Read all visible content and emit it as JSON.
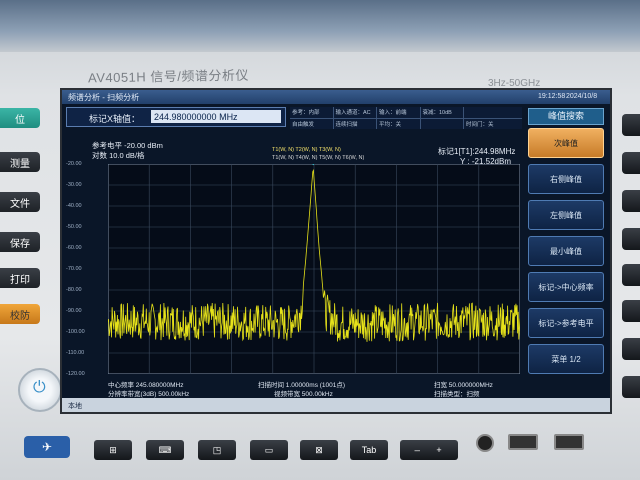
{
  "device": {
    "model": "AV4051H 信号/频谱分析仪",
    "range": "3Hz-50GHz",
    "left_keys": [
      "位",
      "测量",
      "文件",
      "保存",
      "打印",
      "校防"
    ],
    "bottom_keys": [
      "",
      "",
      "",
      "",
      "",
      "Tab",
      "—",
      "+"
    ]
  },
  "screen": {
    "title": "频谱分析 - 扫频分析",
    "time": "19:12:58",
    "date": "2024/10/8",
    "marker_label": "标记X轴值：",
    "marker_value": "244.980000000 MHz",
    "params": [
      "参考：内部",
      "输入通道：AC",
      "输入：前端",
      "衰减：10dB",
      "",
      "自由触发",
      "连续扫描",
      "平均：关",
      "",
      "时间门：关"
    ],
    "ref_level": "参考电平 -20.00 dBm",
    "scale_div": "对数 10.0 dB/格",
    "trace_line1": "T1(W, N)  T2(W, N)  T3(W, N)",
    "trace_line2": "T1(W, N)  T4(W, N)  T5(W, N)  T6(W, N)",
    "marker_readout_1": "标记1[T1]:244.98MHz",
    "marker_readout_2": "Y : -21.52dBm",
    "y_ticks": [
      "-20.00",
      "-30.00",
      "-40.00",
      "-50.00",
      "-60.00",
      "-70.00",
      "-80.00",
      "-90.00",
      "-100.00",
      "-110.00",
      "-120.00"
    ],
    "footer": {
      "center_freq": "中心频率 245.080000MHz",
      "res_bw": "分辨率带宽(3dB) 500.00kHz",
      "sweep_time": "扫描时间 1.00000ms (1001点)",
      "video_bw": "视频带宽 500.00kHz",
      "span": "扫宽 50.000000MHz",
      "sweep_type": "扫描类型：扫频"
    },
    "status": "本地",
    "softkey_title": "峰值搜索",
    "softkeys": [
      "次峰值",
      "右侧峰值",
      "左侧峰值",
      "最小峰值",
      "标记->中心频率",
      "标记->参考电平",
      "菜单 1/2"
    ],
    "softkey_active_index": 0
  },
  "chart_data": {
    "type": "line",
    "x_label": "",
    "y_label": "",
    "ylim": [
      -120,
      -20
    ],
    "x_range_mhz": [
      220.08,
      270.08
    ],
    "series": [
      {
        "values_description_points": [
          [
            220.08,
            -95
          ],
          [
            235.0,
            -95
          ],
          [
            242.0,
            -96
          ],
          [
            243.5,
            -90
          ],
          [
            244.2,
            -60
          ],
          [
            244.98,
            -21.52
          ],
          [
            245.7,
            -60
          ],
          [
            246.4,
            -90
          ],
          [
            248.0,
            -96
          ],
          [
            260.0,
            -95
          ],
          [
            270.08,
            -95
          ]
        ]
      }
    ],
    "grid": true,
    "trace_color": "#e6e21a"
  }
}
